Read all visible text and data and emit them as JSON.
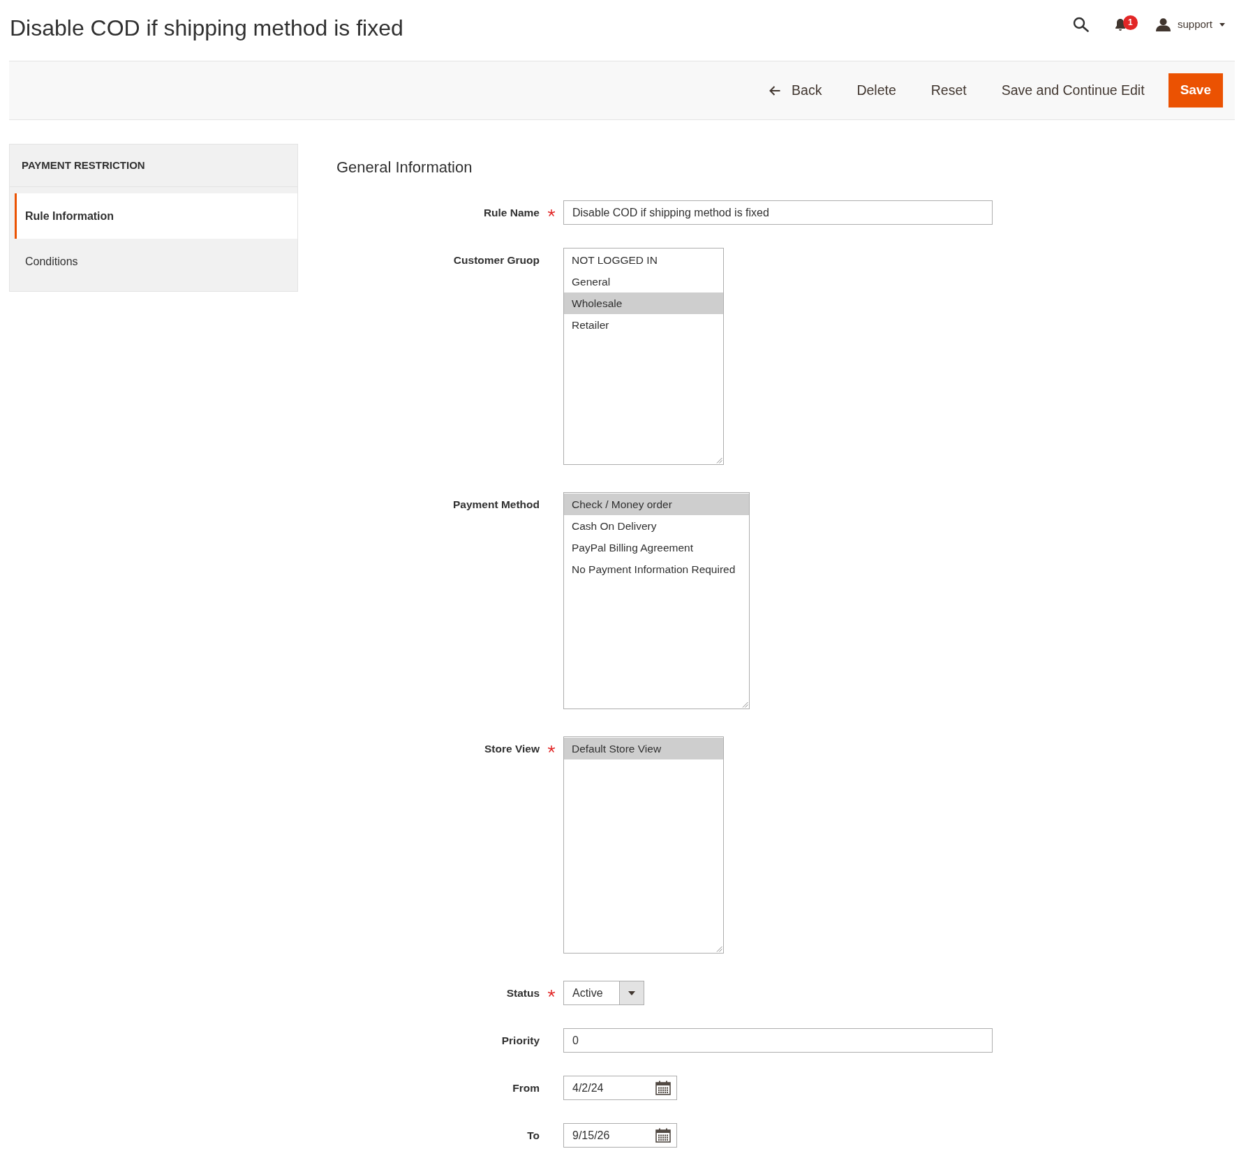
{
  "header": {
    "title": "Disable COD if shipping method is fixed",
    "notification_count": "1",
    "user_name": "support"
  },
  "toolbar": {
    "buttons": [
      {
        "label": "Back",
        "kind": "back"
      },
      {
        "label": "Delete",
        "kind": "plain"
      },
      {
        "label": "Reset",
        "kind": "plain"
      },
      {
        "label": "Save and Continue Edit",
        "kind": "plain"
      },
      {
        "label": "Save",
        "kind": "primary"
      }
    ]
  },
  "sidebar": {
    "title": "PAYMENT RESTRICTION",
    "items": [
      {
        "label": "Rule Information",
        "selected": true
      },
      {
        "label": "Conditions",
        "selected": false
      }
    ]
  },
  "form": {
    "title": "General Information",
    "fields": [
      {
        "kind": "text",
        "label": "Rule Name",
        "required": true,
        "value": "Disable COD if shipping method is fixed"
      },
      {
        "kind": "multiselect",
        "label": "Customer Gruop",
        "required": false,
        "options": [
          {
            "label": "NOT LOGGED IN",
            "selected": false
          },
          {
            "label": "General",
            "selected": false
          },
          {
            "label": "Wholesale",
            "selected": true
          },
          {
            "label": "Retailer",
            "selected": false
          }
        ]
      },
      {
        "kind": "multiselect",
        "label": "Payment Method",
        "required": false,
        "options": [
          {
            "label": "Check / Money order",
            "selected": true
          },
          {
            "label": "Cash On Delivery",
            "selected": false
          },
          {
            "label": "PayPal Billing Agreement",
            "selected": false
          },
          {
            "label": "No Payment Information Required",
            "selected": false
          }
        ]
      },
      {
        "kind": "multiselect",
        "label": "Store View",
        "required": true,
        "options": [
          {
            "label": "Default Store View",
            "selected": true
          }
        ]
      },
      {
        "kind": "select",
        "label": "Status",
        "required": true,
        "value": "Active"
      },
      {
        "kind": "text",
        "label": "Priority",
        "required": false,
        "value": "0"
      },
      {
        "kind": "date",
        "label": "From",
        "required": false,
        "value": "4/2/24"
      },
      {
        "kind": "date",
        "label": "To",
        "required": false,
        "value": "9/15/26"
      }
    ]
  }
}
